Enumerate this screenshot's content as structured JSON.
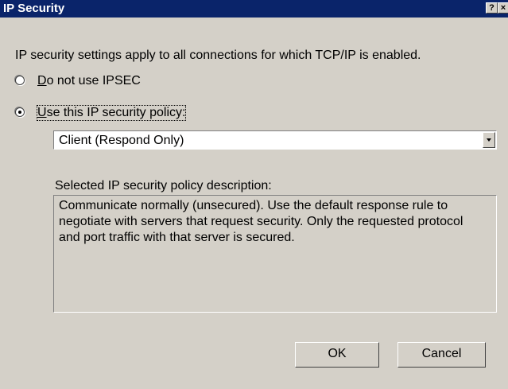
{
  "window": {
    "title": "IP Security",
    "help_glyph": "?",
    "close_glyph": "×"
  },
  "intro_text": "IP security settings apply to all connections for which TCP/IP is enabled.",
  "options": [
    {
      "accel": "D",
      "rest": "o not use IPSEC",
      "selected": false
    },
    {
      "accel": "U",
      "rest": "se this IP security policy:",
      "selected": true
    }
  ],
  "policy_combo": {
    "value": "Client (Respond Only)"
  },
  "description": {
    "label": "Selected IP security policy description:",
    "text": "Communicate normally (unsecured). Use the default response rule to negotiate with servers that request security. Only the requested protocol and port traffic with that server is secured."
  },
  "buttons": {
    "ok": "OK",
    "cancel": "Cancel"
  },
  "colors": {
    "titlebar": "#0a246a",
    "face": "#d4d0c8"
  }
}
